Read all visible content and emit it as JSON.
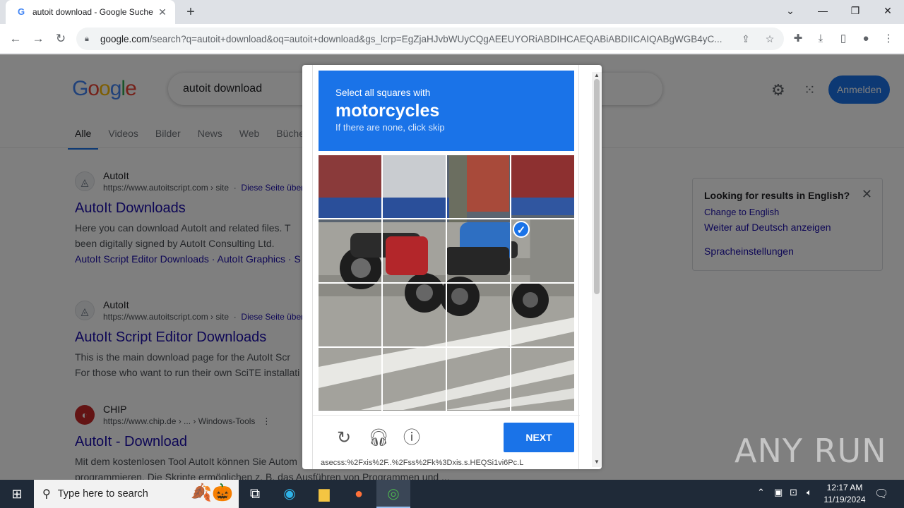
{
  "browser": {
    "tab_title": "autoit download - Google Suche",
    "tab_favicon": "G",
    "new_tab_symbol": "+",
    "url_host": "google.com",
    "url_rest": "/search?q=autoit+download&oq=autoit+download&gs_lcrp=EgZjaHJvbWUyCQgAEEUYORiABDIHCAEQABiABDIICAIQABgWGB4yC..."
  },
  "google": {
    "search_query": "autoit download",
    "signin_label": "Anmelden",
    "tabs": [
      {
        "label": "Alle",
        "active": true
      },
      {
        "label": "Videos"
      },
      {
        "label": "Bilder"
      },
      {
        "label": "News"
      },
      {
        "label": "Web"
      },
      {
        "label": "Bücher"
      }
    ],
    "results": [
      {
        "site": "AutoIt",
        "url": "https://www.autoitscript.com › site",
        "translate": "Diese Seite übersetzen",
        "title": "AutoIt Downloads",
        "snippet1": "Here you can download AutoIt and related files. T",
        "snippet2": "been digitally signed by AutoIt Consulting Ltd.",
        "links": "AutoIt Script Editor Downloads · AutoIt Graphics · S"
      },
      {
        "site": "AutoIt",
        "url": "https://www.autoitscript.com › site",
        "translate": "Diese Seite übersetzen",
        "title": "AutoIt Script Editor Downloads",
        "snippet1": "This is the main download page for the AutoIt Scr",
        "snippet2": "For those who want to run their own SciTE installati"
      },
      {
        "site": "CHIP",
        "url": "https://www.chip.de › ... › Windows-Tools",
        "title": "AutoIt - Download",
        "snippet1": "Mit dem kostenlosen Tool AutoIt können Sie Autom",
        "snippet2": "programmieren. Die Skripte ermöglichen z. B. das Ausführen von Programmen und ..."
      }
    ],
    "english_box": {
      "title": "Looking for results in English?",
      "change": "Change to English",
      "stay": "Weiter auf Deutsch anzeigen",
      "settings": "Spracheinstellungen"
    }
  },
  "captcha": {
    "prompt_line1": "Select all squares with",
    "prompt_object": "motorcycles",
    "prompt_line3": "If there are none, click skip",
    "next_label": "NEXT",
    "selected_tiles": [
      7
    ],
    "url_fragment": "asecss:%2Fxis%2F..%2Fss%2Fk%3Dxis.s.HEQSi1vi6Pc.L",
    "prompt_color": "#1a73e8"
  },
  "watermark": "ANY RUN",
  "taskbar": {
    "search_placeholder": "Type here to search",
    "time": "12:17 AM",
    "date": "11/19/2024"
  }
}
